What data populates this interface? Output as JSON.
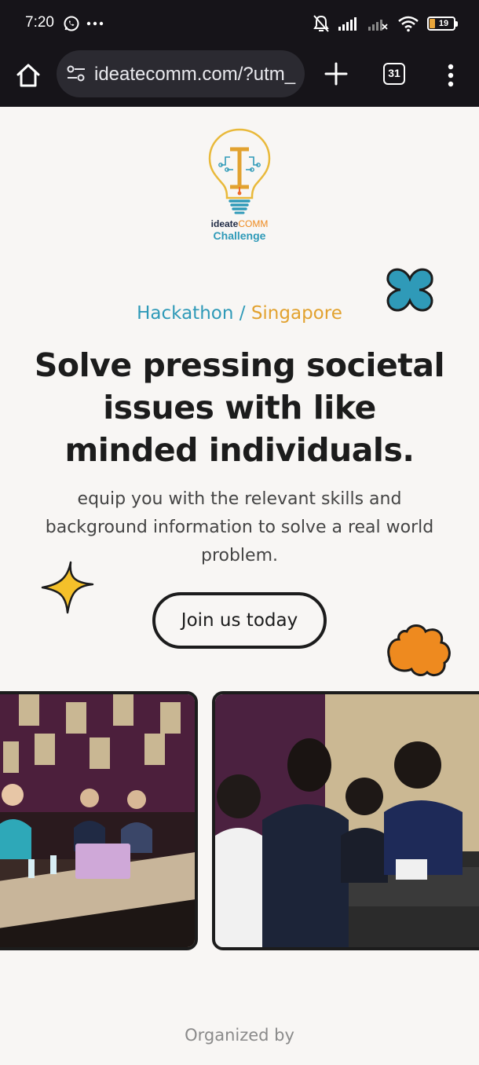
{
  "status_bar": {
    "time": "7:20",
    "battery": "19",
    "icons": [
      "whatsapp-icon",
      "more-notifications-icon",
      "silent-bell-icon",
      "signal-icon",
      "signal-icon-2",
      "wifi-icon",
      "battery-icon"
    ]
  },
  "browser": {
    "url": "ideatecomm.com/?utm_",
    "tab_count": "31",
    "icons": [
      "home-icon",
      "tune-icon",
      "plus-icon",
      "tabs-icon",
      "more-vert-icon"
    ]
  },
  "logo": {
    "line1_prefix": "ideate",
    "line1_accent": "COMM",
    "line2": "Challenge"
  },
  "hero": {
    "eyebrow_part1": "Hackathon / ",
    "eyebrow_part2": "Singapore",
    "headline": "Solve pressing societal issues with like minded individuals.",
    "subtext": "equip you with the relevant skills and background information to solve a real world problem.",
    "cta_label": "Join us today"
  },
  "footer": {
    "organized_by": "Organized by"
  },
  "colors": {
    "teal": "#2f9ab8",
    "orange": "#ee8a1f",
    "yellow": "#e2a22f",
    "dark": "#1c1c1c",
    "background": "#f8f6f4",
    "chrome": "#161419"
  }
}
